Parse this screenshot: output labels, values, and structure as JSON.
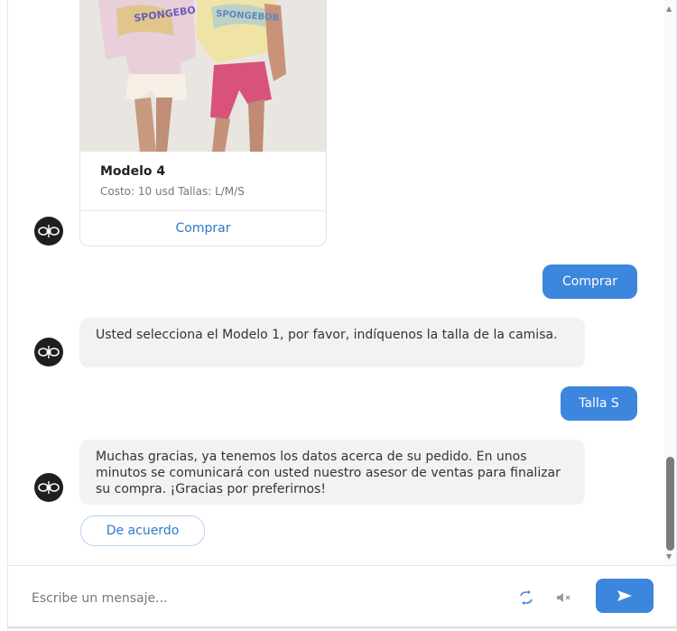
{
  "product_card": {
    "title": "Modelo 4",
    "subtitle": "Costo: 10 usd Tallas: L/M/S",
    "buy_label": "Comprar",
    "image_text_left": "SPONGEBO",
    "image_text_right": "SPONGEBOB"
  },
  "messages": {
    "user_buy": "Comprar",
    "bot_size_prompt": "Usted selecciona el Modelo 1, por favor, indíquenos la talla de la camisa.",
    "user_size": "Talla S",
    "bot_confirmation": "Muchas gracias, ya tenemos los datos acerca de su pedido. En unos minutos se comunicará con usted nuestro asesor de ventas para finalizar su compra. ¡Gracias por preferirnos!"
  },
  "quick_reply": {
    "label": "De acuerdo"
  },
  "composer": {
    "placeholder": "Escribe un mensaje..."
  },
  "colors": {
    "accent": "#3d86dd",
    "link": "#2f78c9",
    "bot_bubble": "#f2f2f2",
    "avatar": "#1f1f1f"
  },
  "icons": {
    "avatar": "bot-logo-icon",
    "refresh": "refresh-icon",
    "mute": "mute-icon",
    "send": "send-icon"
  }
}
